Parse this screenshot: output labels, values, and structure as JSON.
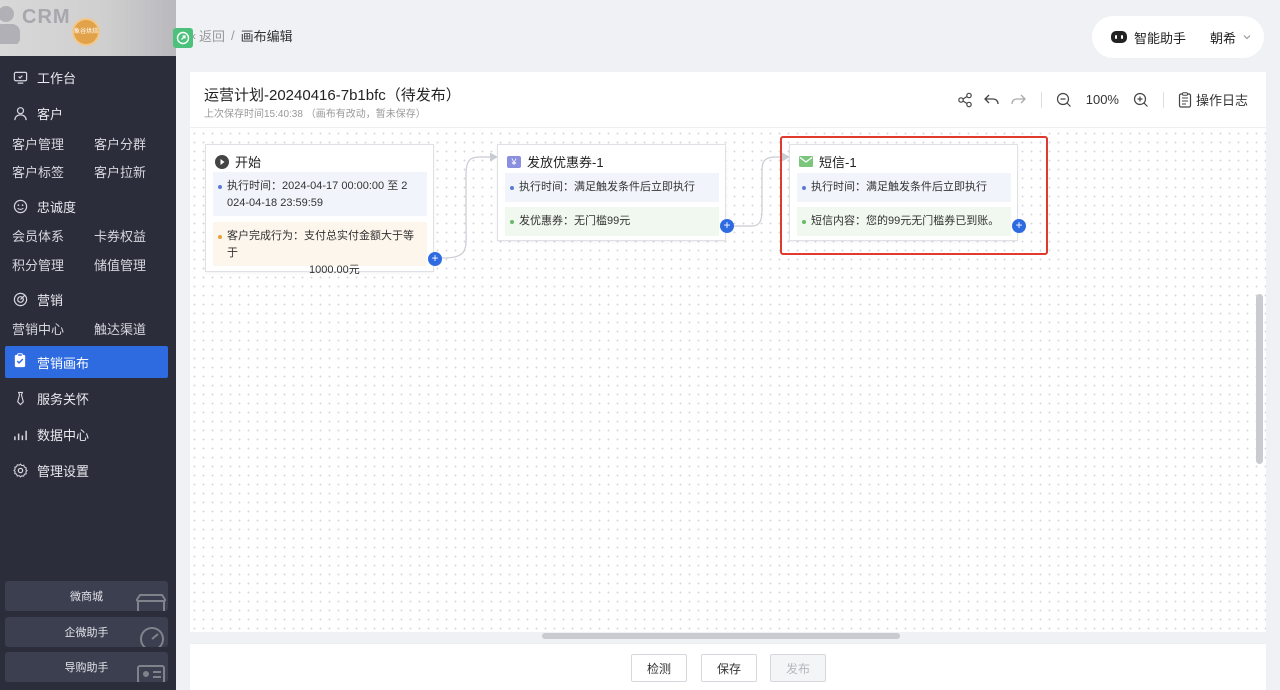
{
  "sidebar": {
    "brand": "CRM",
    "logo_text": "象谷烘焙",
    "workbench": "工作台",
    "customer": {
      "title": "客户",
      "items": [
        "客户管理",
        "客户分群",
        "客户标签",
        "客户拉新"
      ]
    },
    "loyalty": {
      "title": "忠诚度",
      "items": [
        "会员体系",
        "卡券权益",
        "积分管理",
        "储值管理"
      ]
    },
    "marketing": {
      "title": "营销",
      "items": [
        "营销中心",
        "触达渠道"
      ]
    },
    "active": "营销画布",
    "service": "服务关怀",
    "data": "数据中心",
    "settings": "管理设置",
    "bottom": [
      "微商城",
      "企微助手",
      "导购助手"
    ]
  },
  "breadcrumb": {
    "back": "返回",
    "separator": "/",
    "current": "画布编辑"
  },
  "topbar": {
    "assistant": "智能助手",
    "user": "朝希"
  },
  "canvas": {
    "title": "运营计划-20240416-7b1bfc（待发布）",
    "subtitle": "上次保存时间15:40:38 （画布有改动，暂未保存）",
    "zoom": "100%",
    "log_label": "操作日志"
  },
  "nodes": {
    "start": {
      "title": "开始",
      "time_line1": "执行时间：2024-04-17 00:00:00 至 2",
      "time_line2": "024-04-18 23:59:59",
      "behavior_line1": "客户完成行为：支付总实付金额大于等于",
      "behavior_line2": "1000.00元"
    },
    "coupon": {
      "badge": "¥",
      "title": "发放优惠券-1",
      "time": "执行时间：满足触发条件后立即执行",
      "coupon": "发优惠券：无门槛99元"
    },
    "sms": {
      "title": "短信-1",
      "time": "执行时间：满足触发条件后立即执行",
      "content": "短信内容：您的99元无门槛券已到账。"
    }
  },
  "footer": {
    "check": "检测",
    "save": "保存",
    "publish": "发布"
  },
  "colors": {
    "sidebar": "#2b2d3a",
    "accent": "#2f6be0",
    "highlight": "#e0392e"
  }
}
